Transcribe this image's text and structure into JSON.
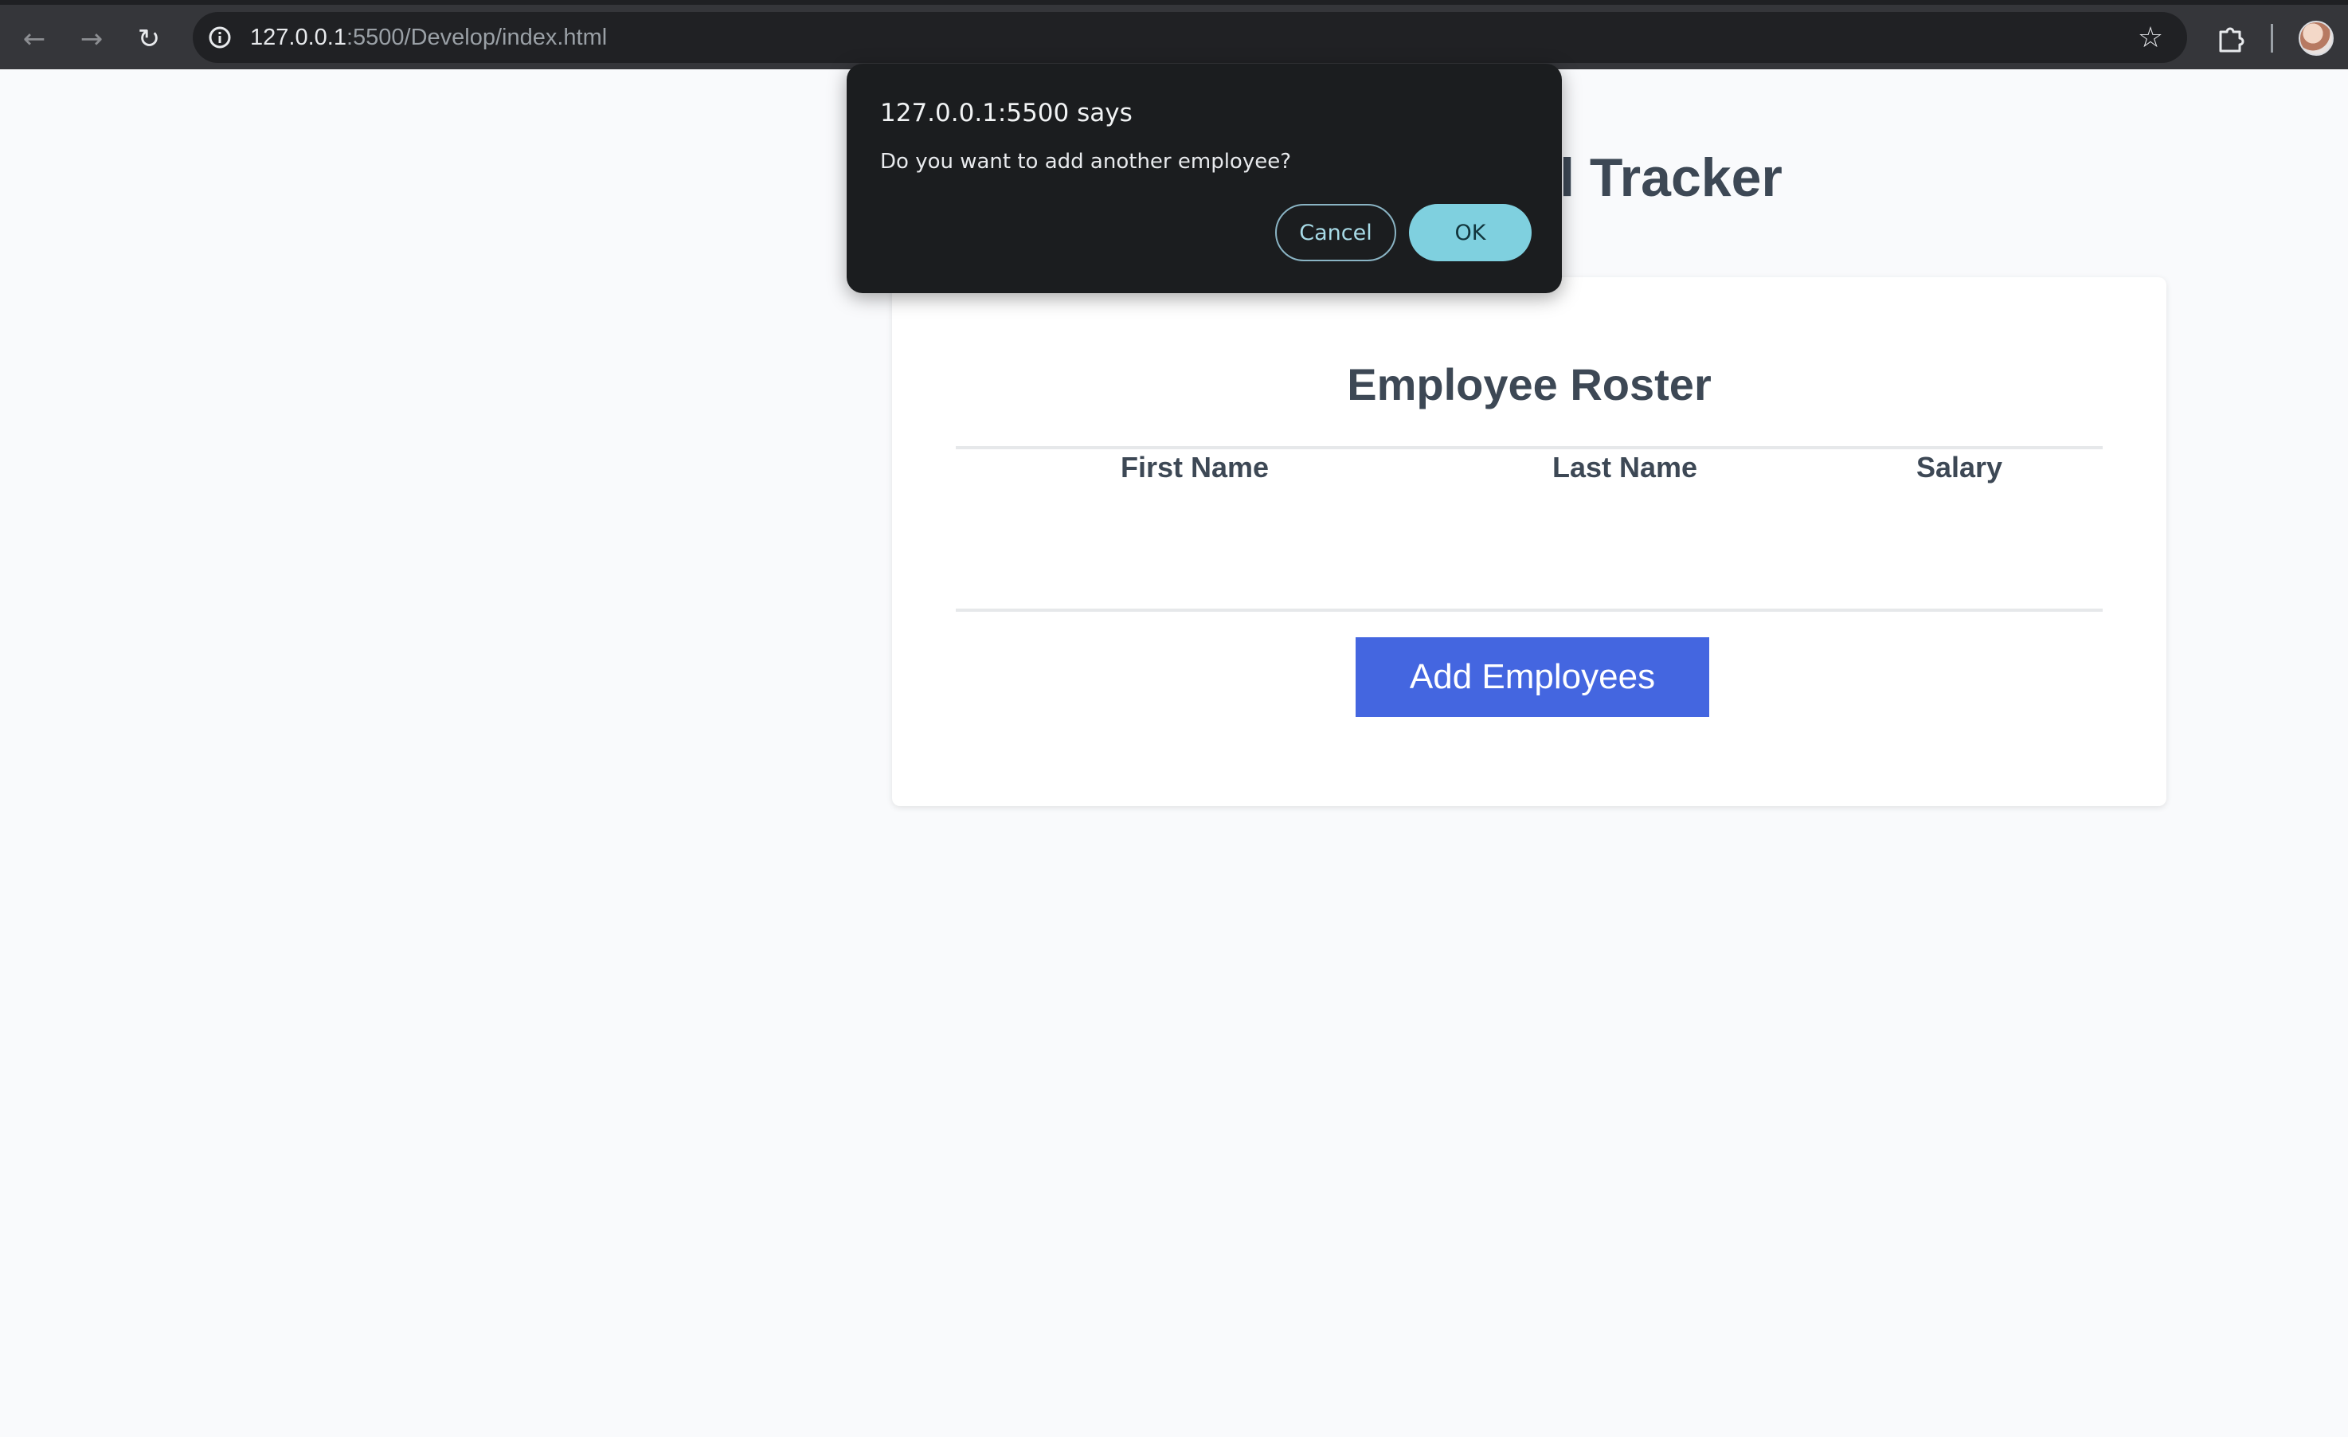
{
  "browser": {
    "url_host": "127.0.0.1",
    "url_rest": ":5500/Develop/index.html",
    "icons": {
      "back": "arrow-left",
      "forward": "arrow-right",
      "reload": "reload",
      "site_info": "info",
      "bookmark": "star",
      "extensions": "puzzle",
      "profile": "avatar"
    }
  },
  "page": {
    "title": "Employee Payroll Tracker",
    "roster_title": "Employee Roster",
    "columns": [
      "First Name",
      "Last Name",
      "Salary"
    ],
    "rows": [],
    "add_button": "Add Employees"
  },
  "dialog": {
    "title": "127.0.0.1:5500 says",
    "message": "Do you want to add another employee?",
    "cancel_label": "Cancel",
    "ok_label": "OK"
  },
  "colors": {
    "primary_button": "#4466e0",
    "dialog_bg": "#1b1d1f",
    "ok_button": "#7fd0df",
    "text_dark": "#3d4855",
    "page_bg": "#f9fafc"
  }
}
